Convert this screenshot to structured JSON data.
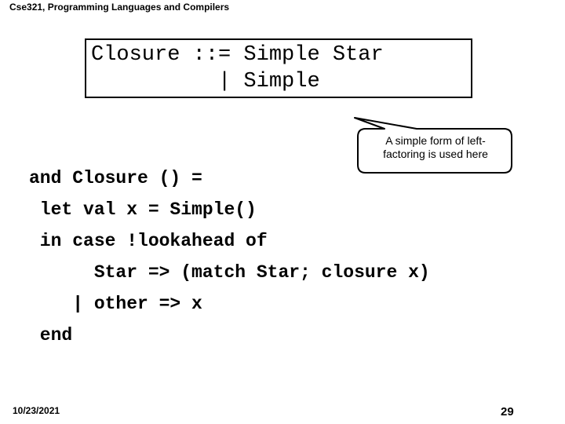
{
  "header": {
    "title": "Cse321, Programming Languages and Compilers"
  },
  "grammar": {
    "lines": [
      "Closure ::= Simple Star",
      "          | Simple"
    ]
  },
  "callout": {
    "line1": "A simple form of left-",
    "line2": "factoring is used here"
  },
  "code": {
    "lines": [
      "and Closure () =",
      " let val x = Simple()",
      " in case !lookahead of",
      "      Star => (match Star; closure x)",
      "    | other => x",
      " end"
    ]
  },
  "footer": {
    "date": "10/23/2021",
    "page": "29"
  }
}
